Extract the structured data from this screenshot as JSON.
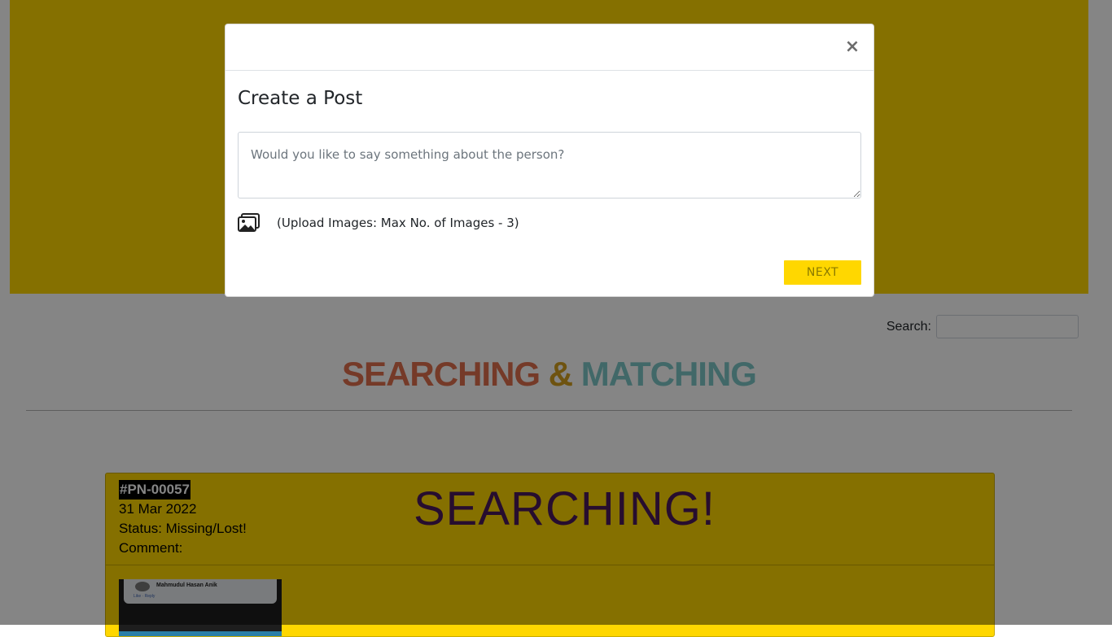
{
  "search": {
    "label": "Search:",
    "value": ""
  },
  "section_title": {
    "word1": "SEARCHING",
    "amp": "&",
    "word2": "MATCHING"
  },
  "card": {
    "id": "#PN-00057",
    "date": "31 Mar 2022",
    "status": "Status: Missing/Lost!",
    "comment": "Comment:",
    "status_title": "SEARCHING!",
    "thumbnail": {
      "name": "Mahmudul Hasan Anik",
      "actions": "Like · Reply"
    }
  },
  "modal": {
    "close_label": "×",
    "title": "Create a Post",
    "textarea_placeholder": "Would you like to say something about the person?",
    "upload_label": "(Upload Images: Max No. of Images - 3)",
    "next_label": "NEXT",
    "upload_icon": "images-icon"
  },
  "colors": {
    "hero": "#ffd700",
    "accent_button": "#ffd700",
    "title_searching": "#e0704d",
    "title_amp": "#d4a020",
    "title_matching": "#7ec8c8",
    "card_status_title": "#4b1a5a"
  }
}
